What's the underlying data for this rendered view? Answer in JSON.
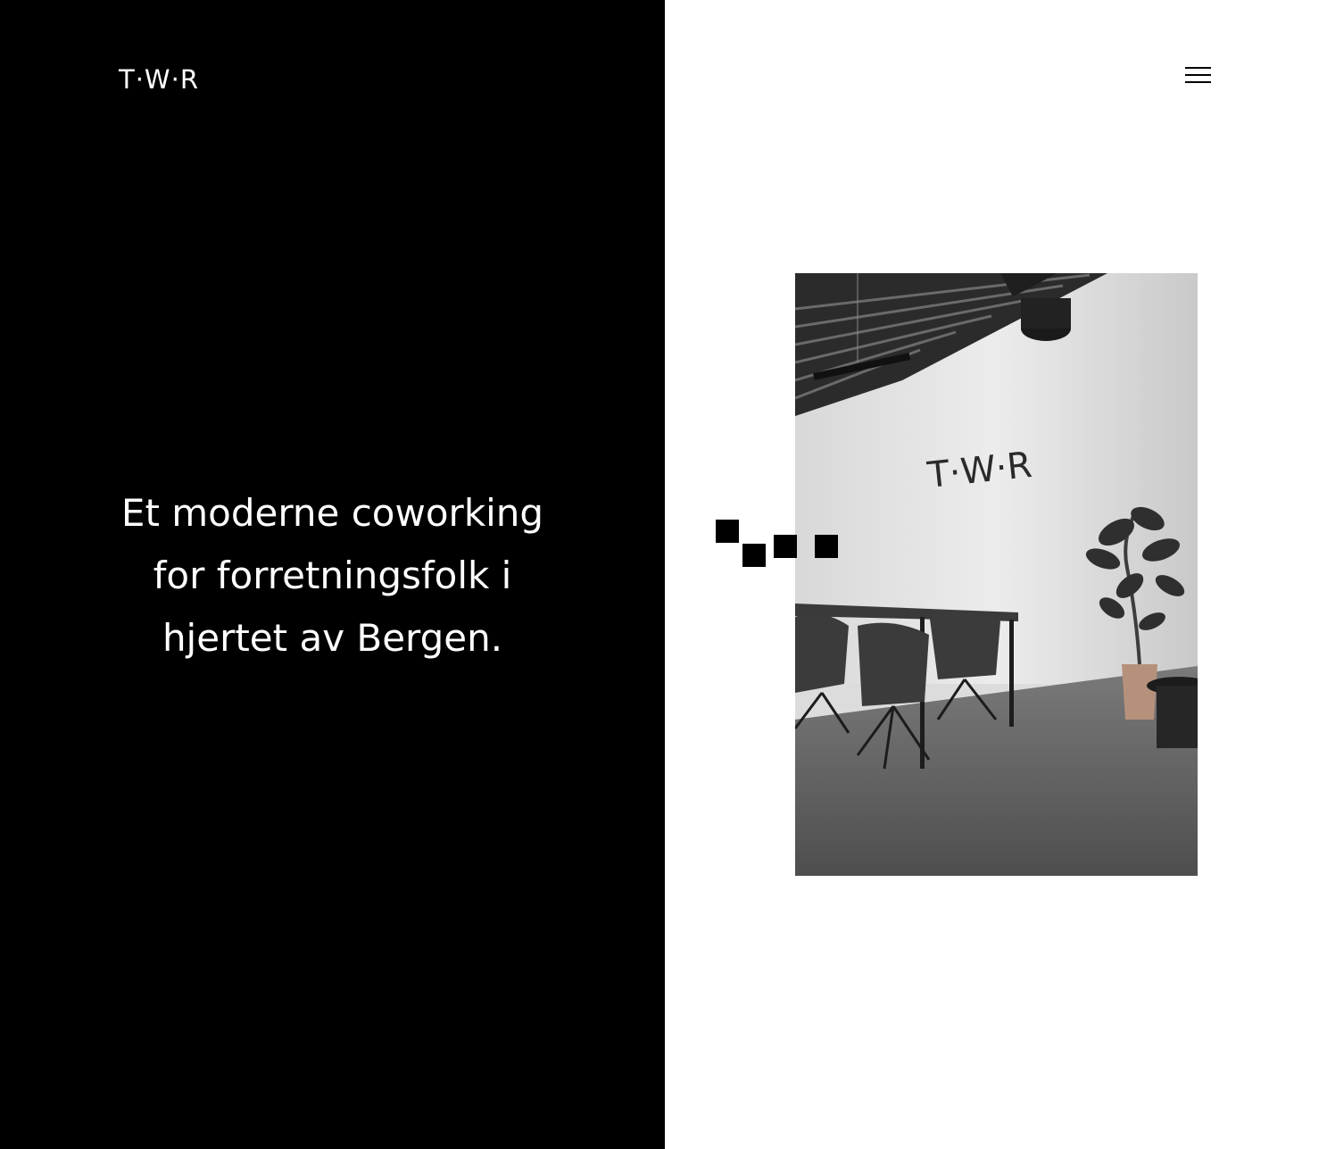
{
  "header": {
    "logo_text": "T·W·R",
    "menu_icon": "hamburger-menu-icon"
  },
  "hero": {
    "line1": "Et moderne coworking",
    "line2": "for forretningsfolk i",
    "line3": "hjertet av Bergen."
  },
  "photo": {
    "wall_sign_text": "T·W·R"
  },
  "colors": {
    "left_background": "#000000",
    "right_background": "#ffffff",
    "text_on_dark": "#ffffff",
    "accent": "#000000"
  }
}
